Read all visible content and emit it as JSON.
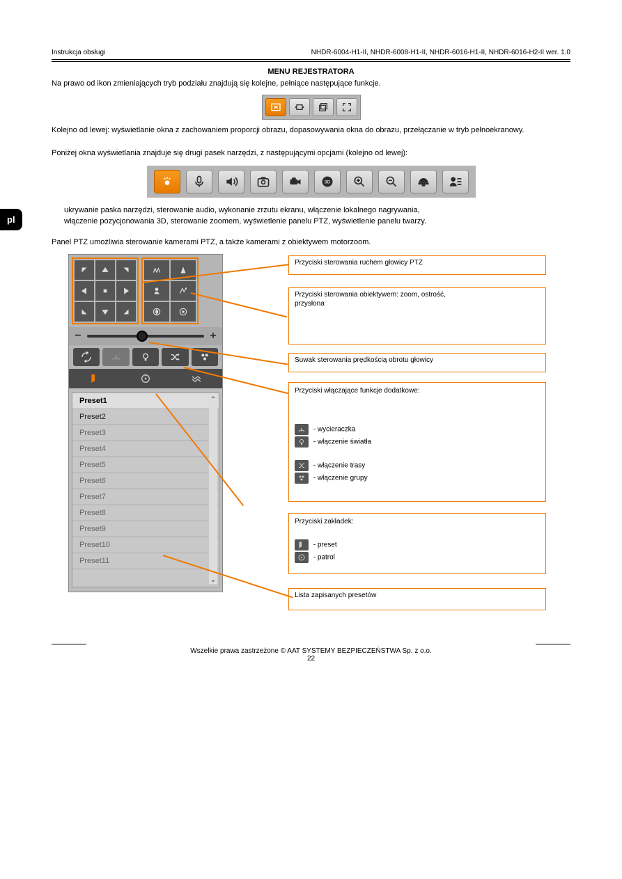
{
  "header": {
    "left": "Instrukcja obsługi",
    "right": "NHDR-6004-H1-II, NHDR-6008-H1-II, NHDR-6016-H1-II, NHDR-6016-H2-II wer. 1.0"
  },
  "tab_label": "pl",
  "top_section": {
    "heading": "MENU REJESTRATORA",
    "para1": "Na prawo od ikon zmieniających tryb podziału znajdują się kolejne, pełniące następujące funkcje."
  },
  "toolbar1_desc": "Kolejno od lewej: wyświetlanie okna z zachowaniem proporcji obrazu, dopasowywania okna do obrazu, przełączanie w tryb pełnoekranowy.",
  "below_text": "Poniżej okna wyświetlania znajduje się drugi pasek narzędzi, z następującymi opcjami (kolejno od lewej):",
  "toolbar2_items": [
    "ukrywanie paska narzędzi, sterowanie audio, wykonanie zrzutu ekranu, włączenie lokalnego nagrywania,",
    "włączenie pozycjonowania 3D, sterowanie zoomem, wyświetlenie panelu PTZ, wyświetlenie panelu twarzy."
  ],
  "ptz_intro": "Panel PTZ umożliwia sterowanie kamerami PTZ, a także kamerami z obiektywem motorzoom.",
  "callouts": {
    "c1": "Przyciski sterowania ruchem głowicy PTZ",
    "c2_line1": "Przyciski sterowania obiektywem: zoom, ostrość,",
    "c2_line2": "przysłona",
    "c3": "Suwak sterowania prędkością obrotu głowicy",
    "c4_intro": "Przyciski włączające funkcje dodatkowe:",
    "c4_items": {
      "wiper": "- wycieraczka",
      "light": "- włączenie światła",
      "tour": "- włączenie trasy",
      "group": "- włączenie grupy"
    },
    "c5_intro": "Przyciski zakładek:",
    "c5_items": {
      "preset": "- preset",
      "patrol": "- patrol"
    },
    "c6": "Lista zapisanych presetów"
  },
  "presets": [
    "Preset1",
    "Preset2",
    "Preset3",
    "Preset4",
    "Preset5",
    "Preset6",
    "Preset7",
    "Preset8",
    "Preset9",
    "Preset10",
    "Preset11"
  ],
  "footer": {
    "copyright": "Wszelkie prawa zastrzeżone © AAT SYSTEMY BEZPIECZEŃSTWA Sp. z o.o.",
    "page": "22"
  }
}
